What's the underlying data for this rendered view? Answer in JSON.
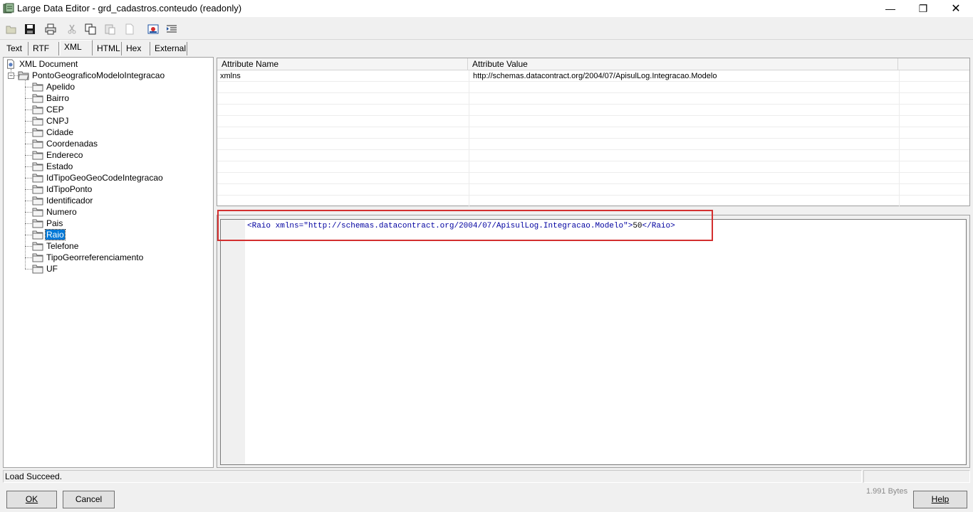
{
  "window": {
    "title": "Large Data Editor - grd_cadastros.conteudo (readonly)",
    "controls": {
      "minimize": "—",
      "maximize": "❐",
      "close": "✕"
    }
  },
  "toolbar": {
    "buttons": [
      "open-icon",
      "save-icon",
      "print-icon",
      "cut-icon",
      "copy-icon",
      "paste-icon",
      "blank-icon",
      "image-icon",
      "indent-icon"
    ]
  },
  "tabs": [
    "Text",
    "RTF",
    "XML",
    "HTML",
    "Hex",
    "External"
  ],
  "active_tab": "XML",
  "tree": {
    "root": "XML Document",
    "element": "PontoGeograficoModeloIntegracao",
    "children": [
      "Apelido",
      "Bairro",
      "CEP",
      "CNPJ",
      "Cidade",
      "Coordenadas",
      "Endereco",
      "Estado",
      "IdTipoGeoGeoCodeIntegracao",
      "IdTipoPonto",
      "Identificador",
      "Numero",
      "Pais",
      "Raio",
      "Telefone",
      "TipoGeorreferenciamento",
      "UF"
    ],
    "selected": "Raio"
  },
  "grid": {
    "headers": [
      "Attribute Name",
      "Attribute Value"
    ],
    "rows": [
      [
        "xmlns",
        "http://schemas.datacontract.org/2004/07/ApisulLog.Integracao.Modelo"
      ]
    ]
  },
  "editor": {
    "open_tag": "<Raio",
    "attr_name": " xmlns=",
    "attr_value": "\"http://schemas.datacontract.org/2004/07/ApisulLog.Integracao.Modelo\"",
    "tag_close": ">",
    "text": "50",
    "end_tag": "</Raio>"
  },
  "status": {
    "message": "Load Succeed.",
    "size": "1.991 Bytes"
  },
  "buttons": {
    "ok": "OK",
    "cancel": "Cancel",
    "help": "Help"
  },
  "colors": {
    "selection": "#0078d7",
    "highlight_box": "#d32f2f",
    "xml_markup": "#0000a0"
  }
}
